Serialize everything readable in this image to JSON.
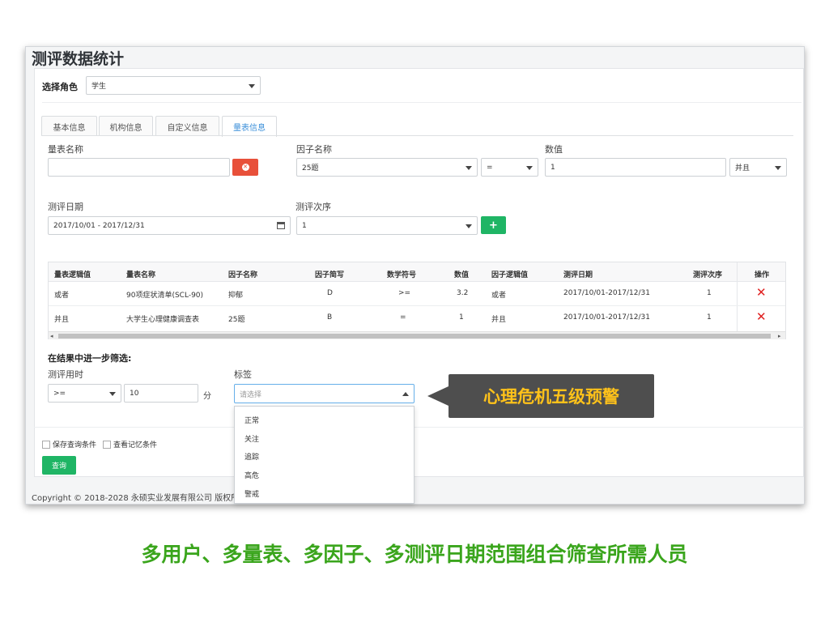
{
  "page_title": "测评数据统计",
  "role": {
    "label": "选择角色",
    "value": "学生"
  },
  "tabs": [
    {
      "label": "基本信息",
      "active": false
    },
    {
      "label": "机构信息",
      "active": false
    },
    {
      "label": "自定义信息",
      "active": false
    },
    {
      "label": "量表信息",
      "active": true
    }
  ],
  "filters": {
    "scale_name_label": "量表名称",
    "scale_name_value": "",
    "factor_name_label": "因子名称",
    "factor_name_value": "25题",
    "operator_value": "=",
    "number_label": "数值",
    "number_value": "1",
    "logic_value": "并且",
    "date_label": "测评日期",
    "date_value": "2017/10/01 - 2017/12/31",
    "order_label": "测评次序",
    "order_value": "1",
    "add_button": "+"
  },
  "table": {
    "headers": [
      "量表逻辑值",
      "量表名称",
      "因子名称",
      "因子简写",
      "数学符号",
      "数值",
      "因子逻辑值",
      "测评日期",
      "测评次序",
      "操作"
    ],
    "rows": [
      [
        "或者",
        "90项症状清单(SCL-90)",
        "抑郁",
        "D",
        ">=",
        "3.2",
        "或者",
        "2017/10/01-2017/12/31",
        "1"
      ],
      [
        "并且",
        "大学生心理健康调查表",
        "25题",
        "B",
        "=",
        "1",
        "并且",
        "2017/10/01-2017/12/31",
        "1"
      ]
    ],
    "delete_icon": "✕",
    "scroll_left": "◂",
    "scroll_right": "▸"
  },
  "refine": {
    "title": "在结果中进一步筛选:",
    "time_label": "测评用时",
    "time_operator": ">=",
    "time_value": "10",
    "time_unit": "分",
    "tag_label": "标签",
    "tag_placeholder": "请选择",
    "tag_options": [
      "正常",
      "关注",
      "追踪",
      "高危",
      "警戒"
    ]
  },
  "options": {
    "save_query": "保存查询条件",
    "view_memory": "查看记忆条件",
    "query_button": "查询"
  },
  "footer": "Copyright © 2018-2028 永硕实业发展有限公司 版权所",
  "callout": "心理危机五级预警",
  "caption": "多用户、多量表、多因子、多测评日期范围组合筛查所需人员",
  "colors": {
    "accent": "#3b8fd9",
    "danger": "#e8503a",
    "success": "#1fb565",
    "caption": "#3aa51c",
    "callout_text": "#ffc21a"
  }
}
